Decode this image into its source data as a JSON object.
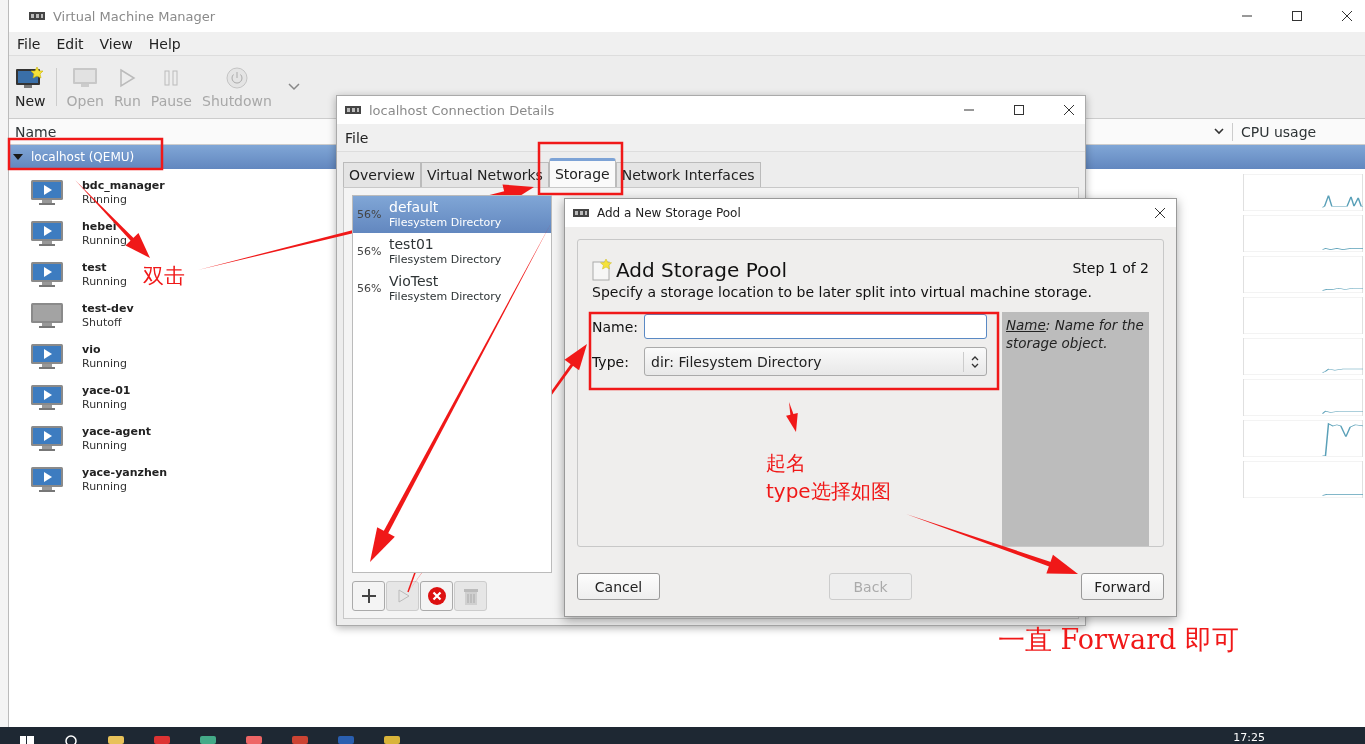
{
  "main_window": {
    "title": "Virtual Machine Manager",
    "menu": [
      "File",
      "Edit",
      "View",
      "Help"
    ],
    "toolbar": [
      {
        "kind": "new",
        "label": "New",
        "disabled": false
      },
      {
        "kind": "open",
        "label": "Open",
        "disabled": true
      },
      {
        "kind": "run",
        "label": "Run",
        "disabled": true
      },
      {
        "kind": "pause",
        "label": "Pause",
        "disabled": true
      },
      {
        "kind": "shutdown",
        "label": "Shutdown",
        "disabled": true
      }
    ],
    "columns": [
      "Name",
      "CPU usage"
    ],
    "connection": {
      "label": "localhost (QEMU)",
      "expanded": true,
      "selected": true
    },
    "vms": [
      {
        "name": "bdc_manager",
        "status": "Running",
        "kind": "running"
      },
      {
        "name": "hebei",
        "status": "Running",
        "kind": "running"
      },
      {
        "name": "test",
        "status": "Running",
        "kind": "running"
      },
      {
        "name": "test-dev",
        "status": "Shutoff",
        "kind": "shutoff"
      },
      {
        "name": "vio",
        "status": "Running",
        "kind": "running"
      },
      {
        "name": "yace-01",
        "status": "Running",
        "kind": "running"
      },
      {
        "name": "yace-agent",
        "status": "Running",
        "kind": "running"
      },
      {
        "name": "yace-yanzhen",
        "status": "Running",
        "kind": "running"
      }
    ]
  },
  "connection_details": {
    "title": "localhost Connection Details",
    "menu": [
      "File"
    ],
    "tabs": [
      {
        "label": "Overview",
        "selected": false
      },
      {
        "label": "Virtual Networks",
        "selected": false
      },
      {
        "label": "Storage",
        "selected": true
      },
      {
        "label": "Network Interfaces",
        "selected": false
      }
    ],
    "pools": [
      {
        "usage": "56%",
        "name": "default",
        "type": "Filesystem Directory",
        "selected": true
      },
      {
        "usage": "56%",
        "name": "test01",
        "type": "Filesystem Directory",
        "selected": false
      },
      {
        "usage": "56%",
        "name": "VioTest",
        "type": "Filesystem Directory",
        "selected": false
      }
    ],
    "pool_buttons": [
      {
        "kind": "add",
        "disabled": false
      },
      {
        "kind": "start",
        "disabled": true
      },
      {
        "kind": "delete",
        "disabled": false
      },
      {
        "kind": "trash",
        "disabled": true
      }
    ]
  },
  "add_pool_dialog": {
    "title": "Add a New Storage Pool",
    "heading": "Add Storage Pool",
    "step": "Step 1 of 2",
    "description": "Specify a storage location to be later split into virtual machine storage.",
    "fields": [
      {
        "kind": "text",
        "label": "Name:"
      },
      {
        "kind": "select",
        "label": "Type:",
        "value": "dir: Filesystem Directory"
      }
    ],
    "help": {
      "term": "Name",
      "text": ": Name for the storage object."
    },
    "buttons": [
      {
        "label": "Cancel",
        "disabled": false
      },
      {
        "label": "Back",
        "disabled": true
      },
      {
        "label": "Forward",
        "disabled": false
      }
    ]
  },
  "annotations": [
    "双击",
    "起名",
    "type选择如图",
    "一直 Forward 即可"
  ],
  "taskbar": {
    "clock": "17:25"
  }
}
